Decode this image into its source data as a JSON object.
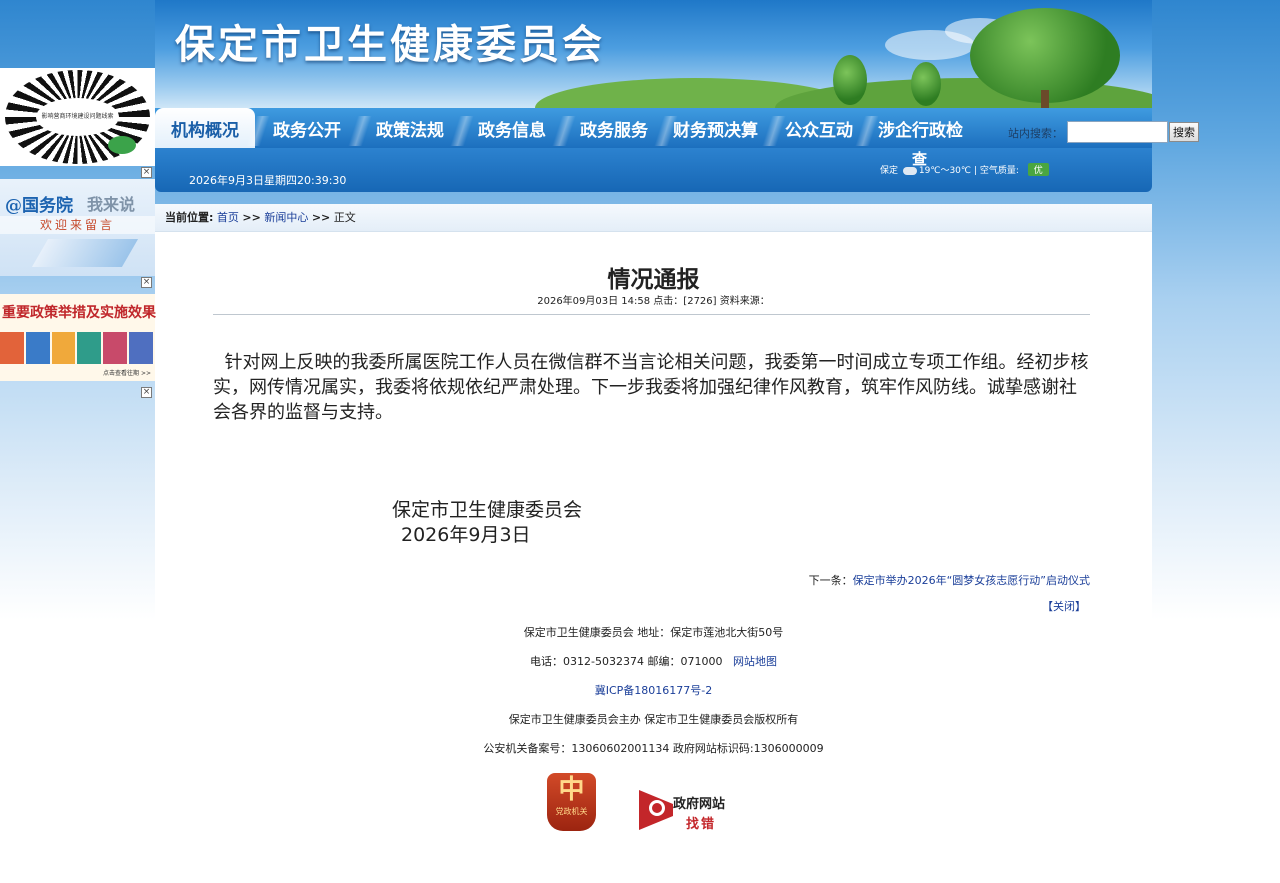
{
  "site": {
    "title": "保定市卫生健康委员会"
  },
  "nav": {
    "items": [
      "机构概况",
      "政务公开",
      "政策法规",
      "政务信息",
      "政务服务",
      "财务预决算",
      "公众互动",
      "涉企行政检"
    ],
    "overflow_char": "查",
    "active_index": 0
  },
  "search": {
    "label": "站内搜索：",
    "value": "",
    "button": "搜索"
  },
  "status_bar": {
    "date": "2026年9月3日星期四20:39:30",
    "city": "保定",
    "temperature": "19℃～30℃",
    "separator": "|",
    "air_label": "空气质量:",
    "air_value": "优"
  },
  "breadcrumb": {
    "label": "当前位置:",
    "home": "首页",
    "sep": ">>",
    "section": "新闻中心",
    "current": "正文"
  },
  "article": {
    "title": "情况通报",
    "meta": "2026年09月03日 14:58  点击：[2726]  资料来源：",
    "body": "针对网上反映的我委所属医院工作人员在微信群不当言论相关问题，我委第一时间成立专项工作组。经初步核实，网传情况属实，我委将依规依纪严肃处理。下一步我委将加强纪律作风教育，筑牢作风防线。诚挚感谢社会各界的监督与支持。",
    "signature_org": "保定市卫生健康委员会",
    "signature_date": "2026年9月3日"
  },
  "pager": {
    "next_label": "下一条：",
    "next_title": "保定市举办2026年“圆梦女孩志愿行动”启动仪式",
    "close": "【关闭】"
  },
  "footer": {
    "org_address": "保定市卫生健康委员会  地址：保定市莲池北大街50号",
    "contact": "电话：0312-5032374  邮编：071000",
    "sitemap": "网站地图",
    "icp": "冀ICP备18016177号-2",
    "copyright": "保定市卫生健康委员会主办  保定市卫生健康委员会版权所有",
    "police_record": "公安机关备案号：13060602001134  政府网站标识码:1306000009"
  },
  "badges": {
    "party": "党政机关",
    "gov_site": "政府网站",
    "gov_find": "找错"
  },
  "sidebar": {
    "qr_caption": "影响营商环境建设问题线索",
    "guowuyuan_a": "@国务院",
    "guowuyuan_b": "我来说",
    "guowuyuan_c": "欢迎来留言",
    "policy_title": "重要政策举措及实施效果",
    "policy_more": "点击查看往期 >>",
    "close_char": "×"
  },
  "colors": {
    "nav_bg": "#1c6fbe",
    "link": "#1a3e99",
    "accent_red": "#c0272b"
  }
}
